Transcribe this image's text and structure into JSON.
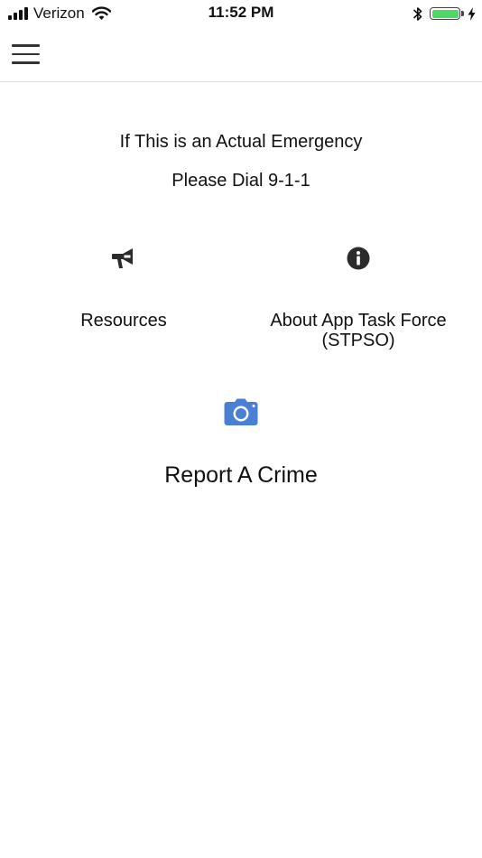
{
  "status_bar": {
    "carrier": "Verizon",
    "time": "11:52 PM",
    "signal_icon": "signal-bars-icon",
    "wifi_icon": "wifi-icon",
    "bluetooth_icon": "bluetooth-icon",
    "battery_icon": "battery-icon",
    "battery_level": 1.0,
    "charging_icon": "charging-bolt-icon",
    "battery_color": "#4cd964"
  },
  "nav": {
    "menu_icon": "hamburger-menu-icon"
  },
  "notice": {
    "line1": "If This is an Actual Emergency",
    "line2": "Please Dial 9-1-1"
  },
  "tiles": {
    "resources": {
      "label": "Resources",
      "icon": "megaphone-icon"
    },
    "about": {
      "label_line1": "About App Task Force",
      "label_line2": "(STPSO)",
      "icon": "info-circle-icon"
    },
    "report": {
      "label": "Report A Crime",
      "icon": "camera-icon",
      "icon_color": "#4a7fd6"
    }
  }
}
